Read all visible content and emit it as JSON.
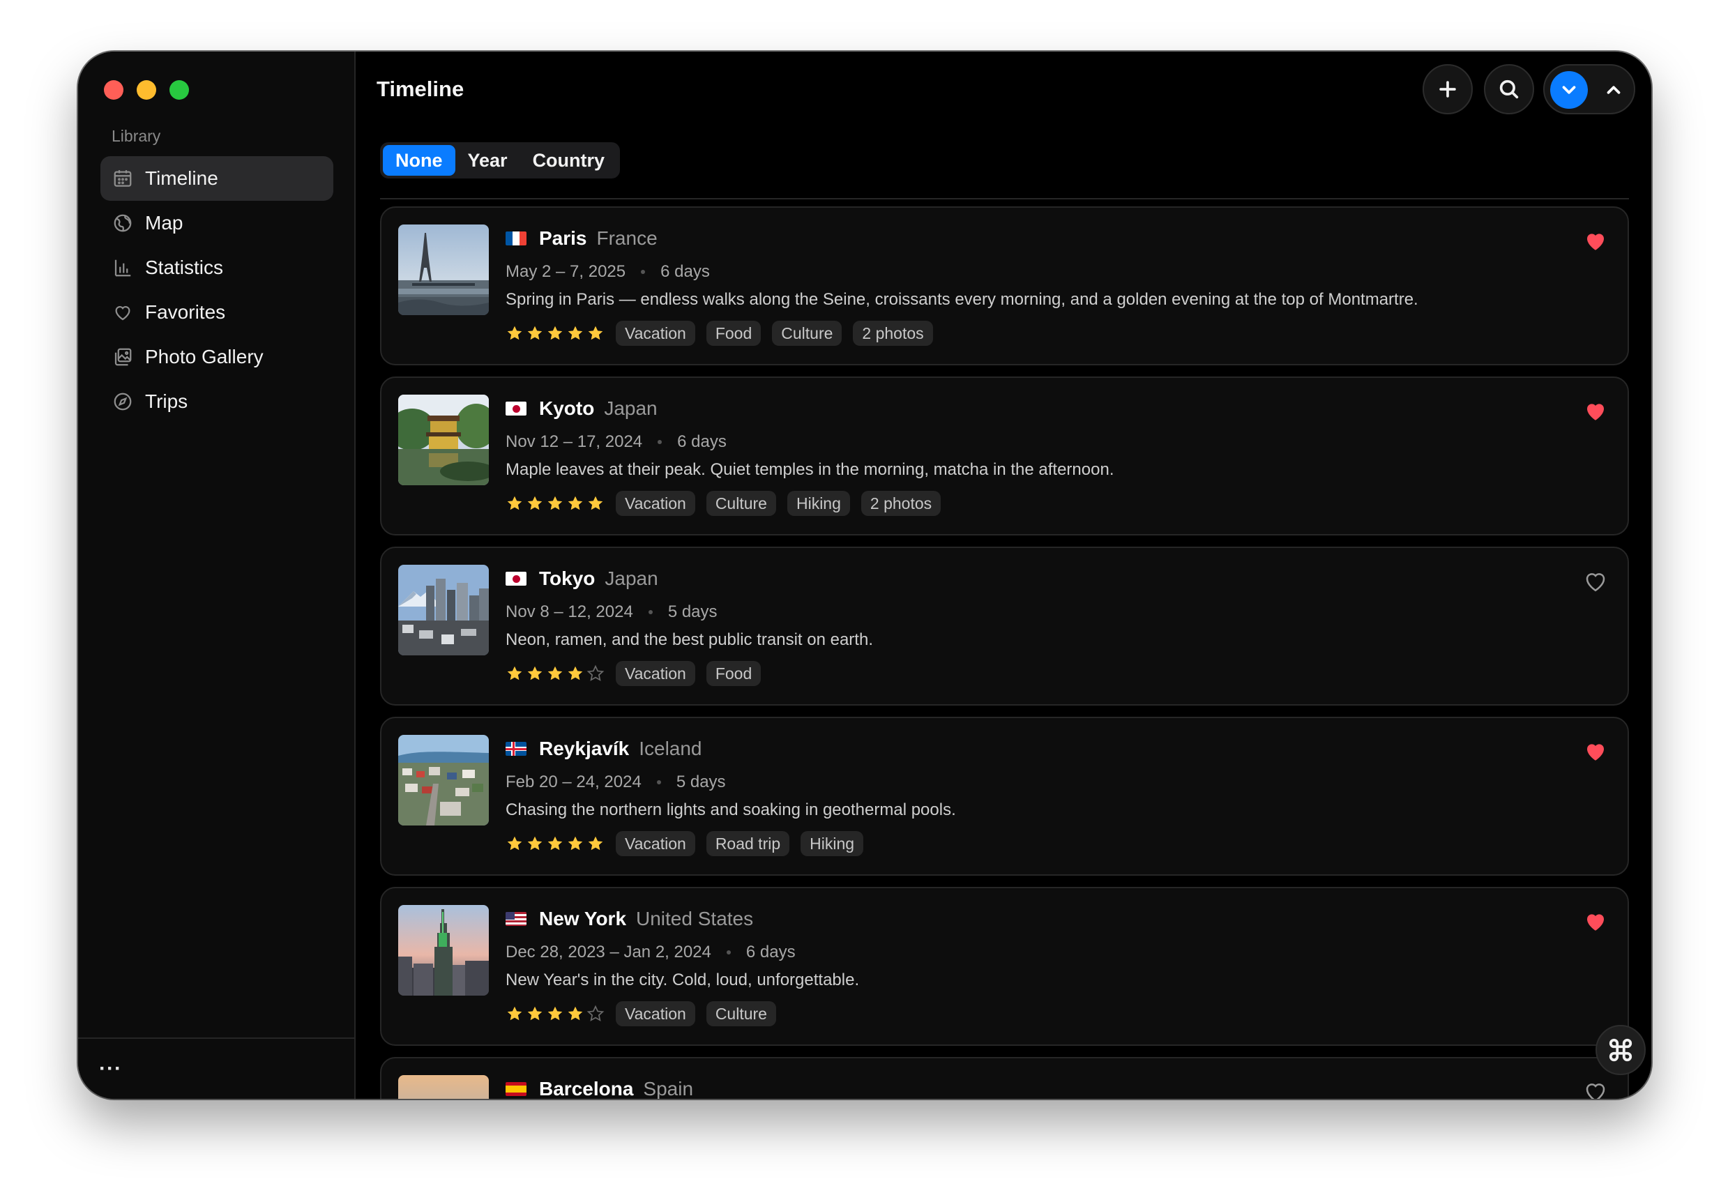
{
  "sidebar": {
    "section_label": "Library",
    "items": [
      {
        "label": "Timeline",
        "icon": "calendar-icon",
        "active": true
      },
      {
        "label": "Map",
        "icon": "globe-icon",
        "active": false
      },
      {
        "label": "Statistics",
        "icon": "chart-icon",
        "active": false
      },
      {
        "label": "Favorites",
        "icon": "heart-icon",
        "active": false
      },
      {
        "label": "Photo Gallery",
        "icon": "photo-gallery-icon",
        "active": false
      },
      {
        "label": "Trips",
        "icon": "compass-icon",
        "active": false
      }
    ],
    "more_label": "···"
  },
  "header": {
    "title": "Timeline",
    "buttons": [
      "add-icon",
      "search-icon",
      "chevron-down-icon",
      "chevron-up-icon"
    ],
    "accent_color": "#0a7cff"
  },
  "grouping": {
    "options": [
      "None",
      "Year",
      "Country"
    ],
    "selected": "None"
  },
  "trips": [
    {
      "city": "Paris",
      "country": "France",
      "dates": "May 2 – 7, 2025",
      "duration": "6 days",
      "description": "Spring in Paris — endless walks along the Seine, croissants every morning, and a golden evening at the top of Montmartre.",
      "rating": 5,
      "tags": [
        "Vacation",
        "Food",
        "Culture",
        "2 photos"
      ],
      "favorite": true
    },
    {
      "city": "Kyoto",
      "country": "Japan",
      "dates": "Nov 12 – 17, 2024",
      "duration": "6 days",
      "description": "Maple leaves at their peak. Quiet temples in the morning, matcha in the afternoon.",
      "rating": 5,
      "tags": [
        "Vacation",
        "Culture",
        "Hiking",
        "2 photos"
      ],
      "favorite": true
    },
    {
      "city": "Tokyo",
      "country": "Japan",
      "dates": "Nov 8 – 12, 2024",
      "duration": "5 days",
      "description": "Neon, ramen, and the best public transit on earth.",
      "rating": 4,
      "tags": [
        "Vacation",
        "Food"
      ],
      "favorite": false
    },
    {
      "city": "Reykjavík",
      "country": "Iceland",
      "dates": "Feb 20 – 24, 2024",
      "duration": "5 days",
      "description": "Chasing the northern lights and soaking in geothermal pools.",
      "rating": 5,
      "tags": [
        "Vacation",
        "Road trip",
        "Hiking"
      ],
      "favorite": true
    },
    {
      "city": "New York",
      "country": "United States",
      "dates": "Dec 28, 2023 – Jan 2, 2024",
      "duration": "6 days",
      "description": "New Year's in the city. Cold, loud, unforgettable.",
      "rating": 4,
      "tags": [
        "Vacation",
        "Culture"
      ],
      "favorite": true
    },
    {
      "city": "Barcelona",
      "country": "Spain",
      "dates": "",
      "duration": "",
      "description": "",
      "rating": 0,
      "tags": [],
      "favorite": false
    }
  ],
  "colors": {
    "favorite": "#ff4d5a",
    "star": "#ffc93c",
    "star_empty": "#6a6a6a"
  }
}
